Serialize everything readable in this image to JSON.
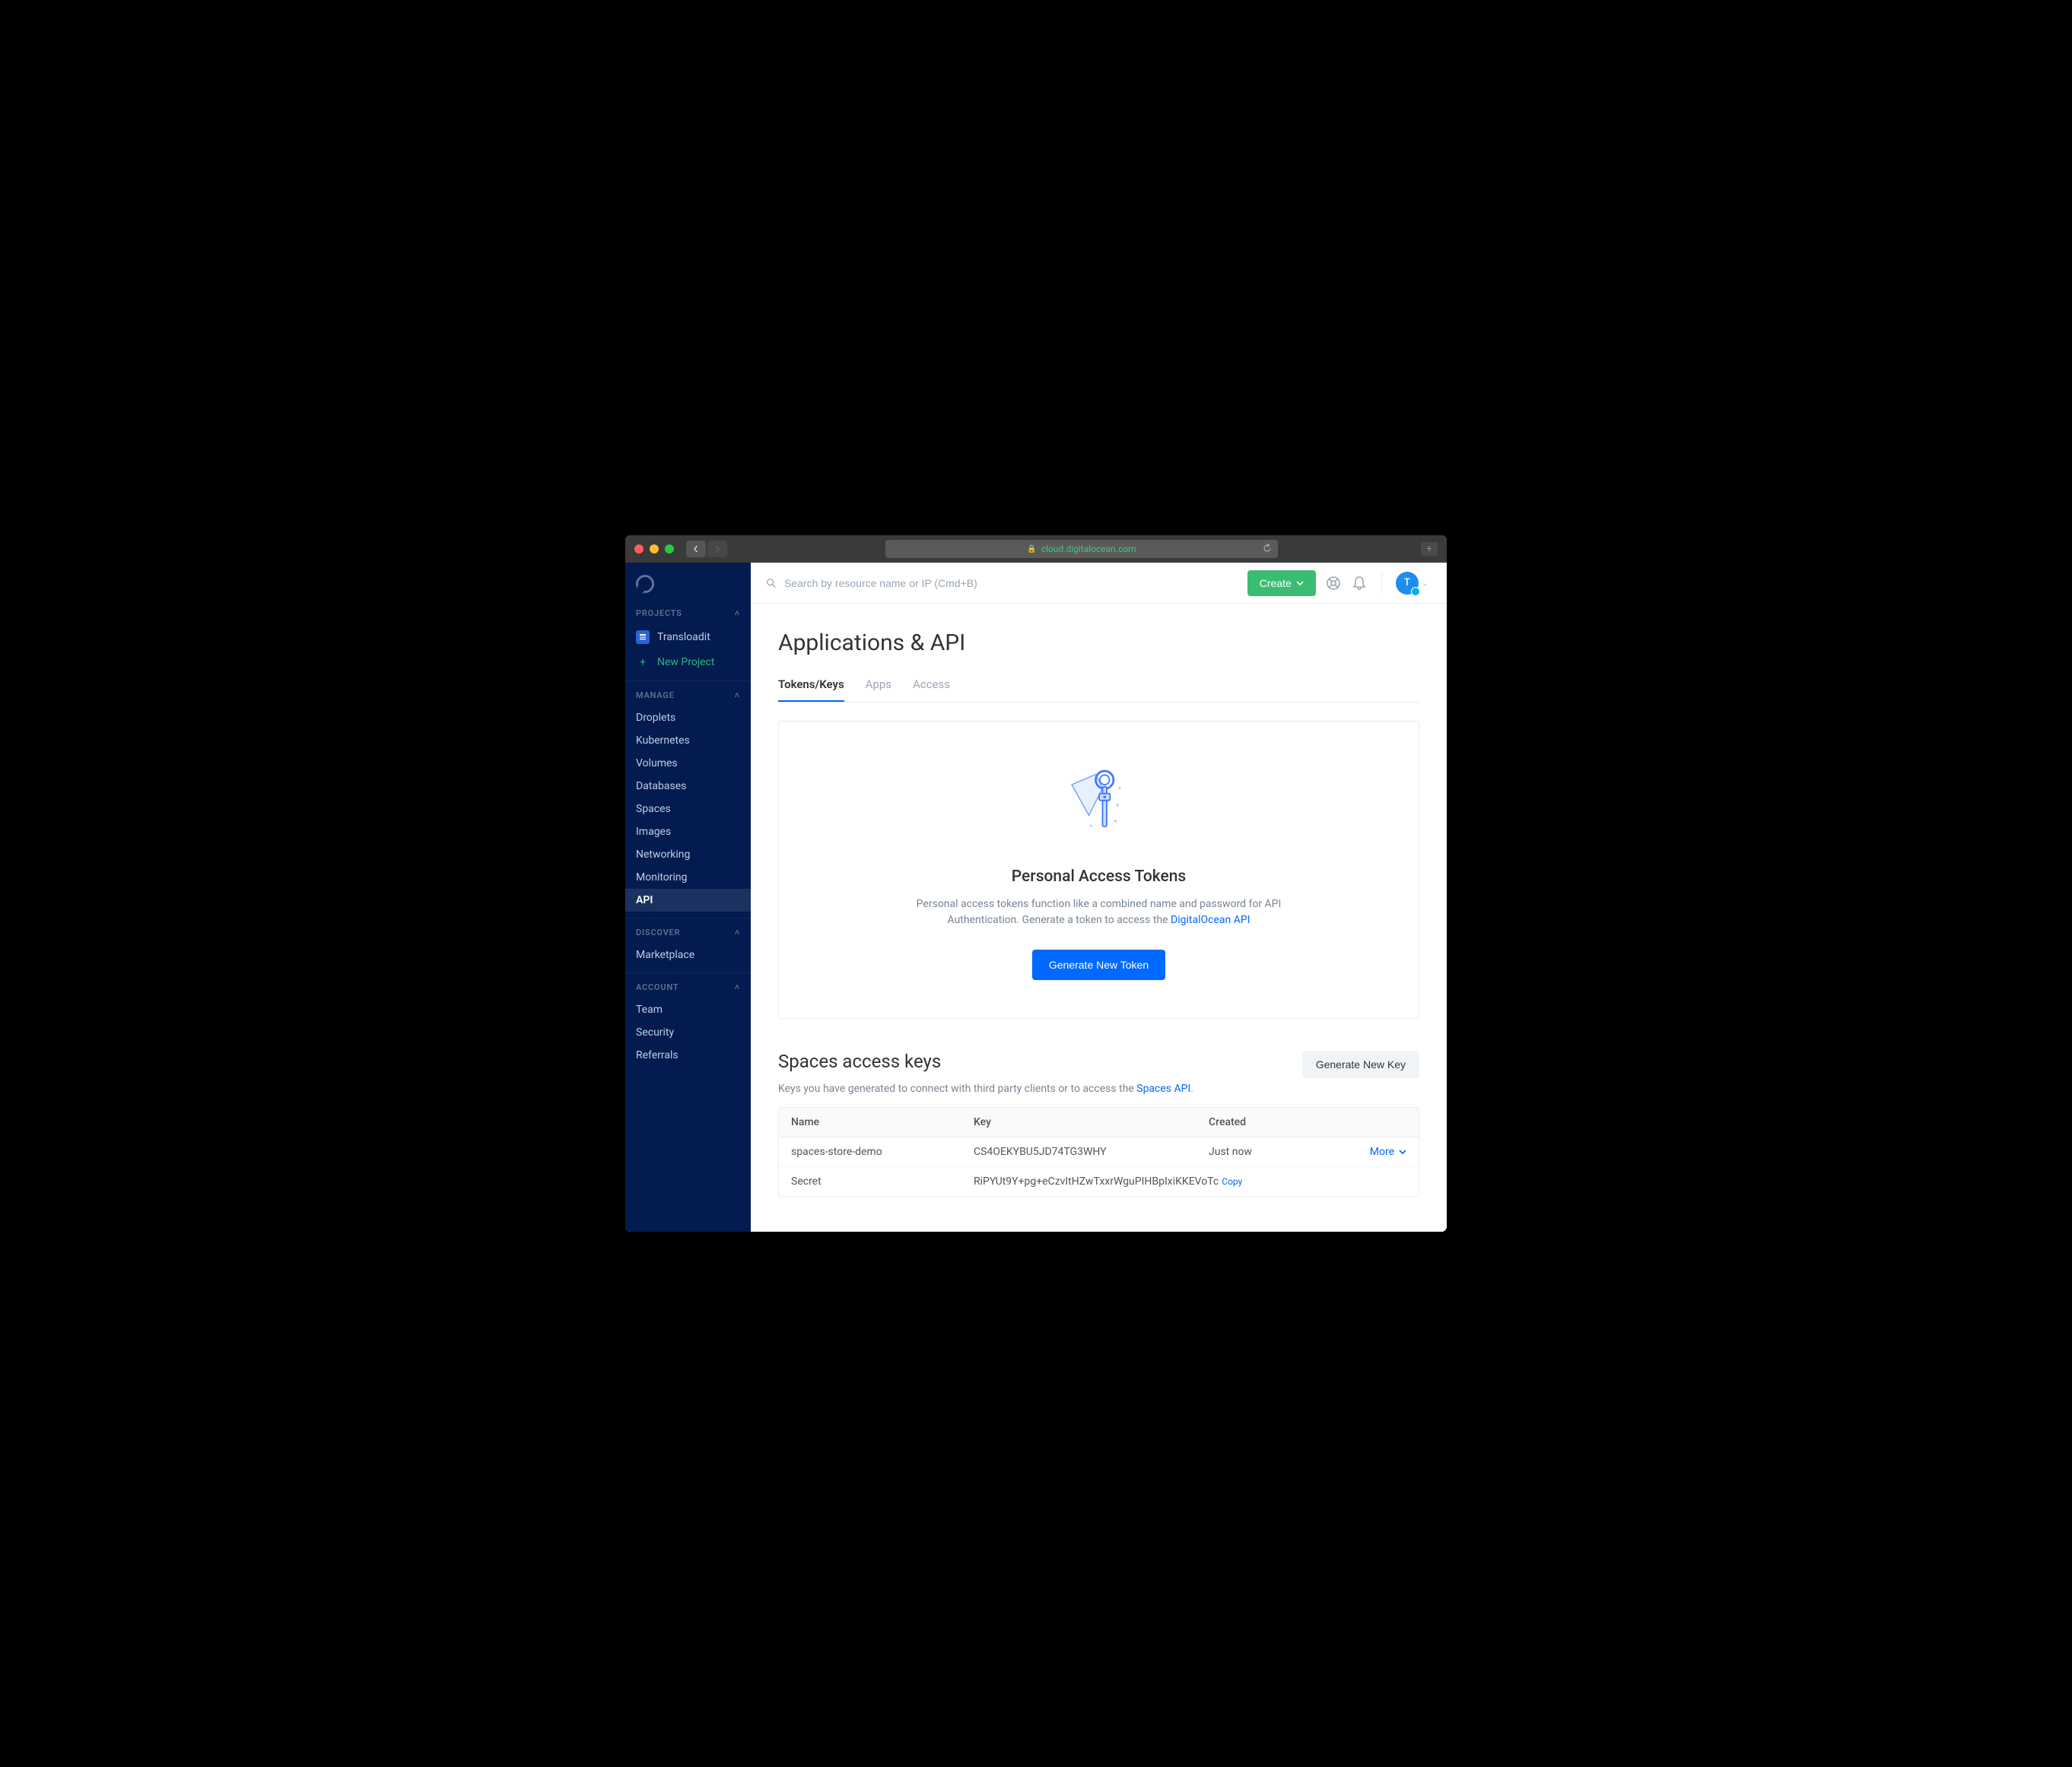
{
  "browser": {
    "url": "cloud.digitalocean.com"
  },
  "sidebar": {
    "sections": {
      "projects_label": "PROJECTS",
      "manage_label": "MANAGE",
      "discover_label": "DISCOVER",
      "account_label": "ACCOUNT"
    },
    "project_name": "Transloadit",
    "new_project": "New Project",
    "manage_items": [
      "Droplets",
      "Kubernetes",
      "Volumes",
      "Databases",
      "Spaces",
      "Images",
      "Networking",
      "Monitoring",
      "API"
    ],
    "discover_items": [
      "Marketplace"
    ],
    "account_items": [
      "Team",
      "Security",
      "Referrals"
    ]
  },
  "topbar": {
    "search_placeholder": "Search by resource name or IP (Cmd+B)",
    "create_label": "Create",
    "avatar_initial": "T"
  },
  "page": {
    "title": "Applications & API",
    "tabs": [
      "Tokens/Keys",
      "Apps",
      "Access"
    ]
  },
  "tokens_panel": {
    "heading": "Personal Access Tokens",
    "description_prefix": "Personal access tokens function like a combined name and password for API Authentication. Generate a token to access the ",
    "api_link": "DigitalOcean API",
    "button": "Generate New Token"
  },
  "spaces_keys": {
    "title": "Spaces access keys",
    "desc_prefix": "Keys you have generated to connect with third party clients or to access the ",
    "api_link": "Spaces API",
    "desc_suffix": ".",
    "button": "Generate New Key",
    "columns": {
      "name": "Name",
      "key": "Key",
      "created": "Created"
    },
    "rows": [
      {
        "name": "spaces-store-demo",
        "key": "CS4OEKYBU5JD74TG3WHY",
        "created": "Just now",
        "more": "More"
      },
      {
        "name": "Secret",
        "key": "RiPYUt9Y+pg+eCzvItHZwTxxrWguPIHBpIxiKKEVoTc",
        "copy": "Copy"
      }
    ]
  }
}
